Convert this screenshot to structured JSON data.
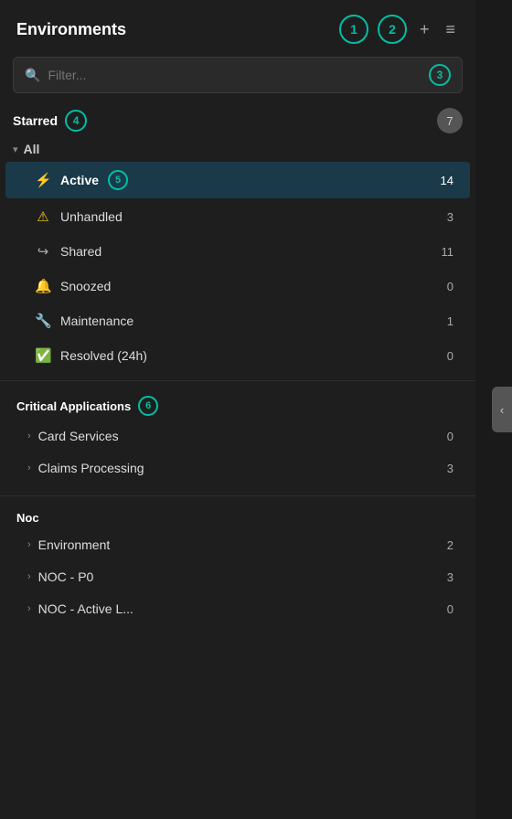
{
  "header": {
    "title": "Environments",
    "badge1": "1",
    "badge2": "2",
    "add_label": "+",
    "list_label": "≡"
  },
  "filter": {
    "placeholder": "Filter...",
    "badge3": "3"
  },
  "starred_section": {
    "label": "Starred",
    "badge": "4",
    "collapse_badge": "7",
    "all_group": "All",
    "items": [
      {
        "id": "active",
        "icon": "⚡",
        "label": "Active",
        "badge": "5",
        "count": "14",
        "active": true
      },
      {
        "id": "unhandled",
        "icon": "⚠",
        "label": "Unhandled",
        "count": "3",
        "active": false
      },
      {
        "id": "shared",
        "icon": "↪",
        "label": "Shared",
        "count": "11",
        "active": false
      },
      {
        "id": "snoozed",
        "icon": "🔔",
        "label": "Snoozed",
        "count": "0",
        "active": false
      },
      {
        "id": "maintenance",
        "icon": "🔧",
        "label": "Maintenance",
        "count": "1",
        "active": false
      },
      {
        "id": "resolved",
        "icon": "✓",
        "label": "Resolved (24h)",
        "count": "0",
        "active": false
      }
    ]
  },
  "critical_apps": {
    "label": "Critical Applications",
    "badge": "6",
    "items": [
      {
        "label": "Card Services",
        "count": "0"
      },
      {
        "label": "Claims Processing",
        "count": "3"
      }
    ]
  },
  "noc_section": {
    "label": "Noc",
    "items": [
      {
        "label": "Environment",
        "count": "2"
      },
      {
        "label": "NOC - P0",
        "count": "3"
      },
      {
        "label": "NOC - Active L...",
        "count": "0"
      }
    ]
  }
}
